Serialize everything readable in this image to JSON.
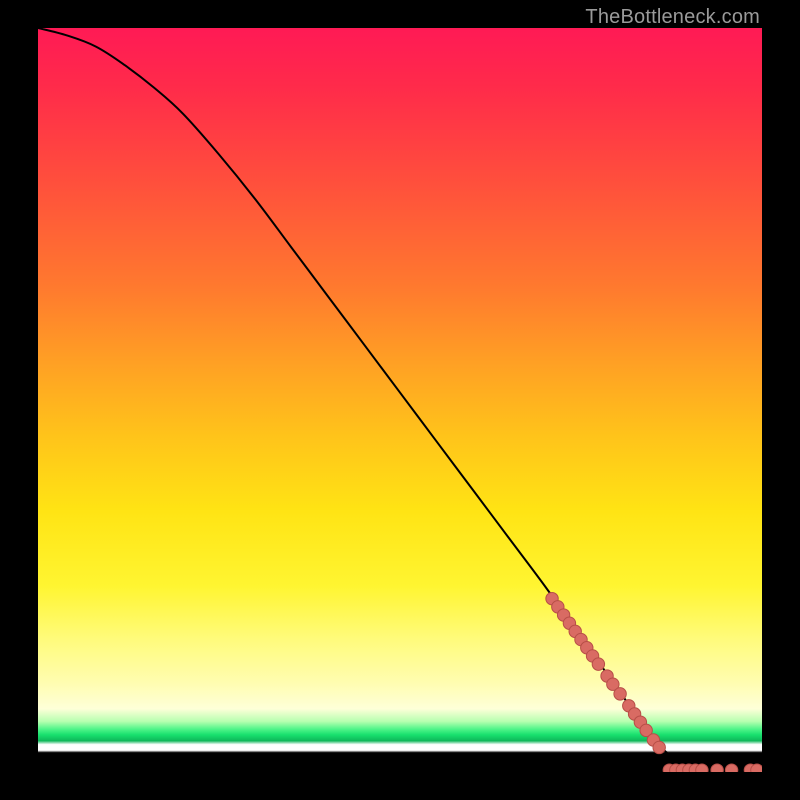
{
  "watermark": "TheBottleneck.com",
  "colors": {
    "curve": "#000000",
    "dot_fill": "#d96b63",
    "dot_stroke": "#b74e47"
  },
  "chart_data": {
    "type": "line",
    "title": "",
    "xlabel": "",
    "ylabel": "",
    "xlim": [
      0,
      100
    ],
    "ylim": [
      0,
      100
    ],
    "grid": false,
    "legend": false,
    "series": [
      {
        "name": "curve",
        "x": [
          0,
          4,
          8,
          12,
          16,
          20,
          25,
          30,
          35,
          40,
          45,
          50,
          55,
          60,
          65,
          70,
          74,
          78,
          82,
          85,
          88,
          90,
          92,
          94,
          96,
          98,
          100
        ],
        "y": [
          100,
          99,
          97.5,
          95,
          92,
          88.5,
          83,
          77,
          70.5,
          64,
          57.5,
          51,
          44.5,
          38,
          31.5,
          25,
          19.5,
          14,
          8.5,
          4.5,
          1.6,
          0.6,
          0.25,
          0.25,
          0.25,
          0.25,
          0.25
        ]
      }
    ],
    "dots_on_curve": {
      "name": "highlighted-segment",
      "x": [
        71.0,
        71.8,
        72.6,
        73.4,
        74.2,
        75.0,
        75.8,
        76.6,
        77.4,
        78.6,
        79.4,
        80.4,
        81.6,
        82.4,
        83.2,
        84.0,
        85.0,
        85.8
      ],
      "y": [
        23.3,
        22.2,
        21.1,
        20.0,
        18.9,
        17.8,
        16.7,
        15.6,
        14.5,
        12.9,
        11.8,
        10.5,
        8.9,
        7.8,
        6.7,
        5.6,
        4.3,
        3.3
      ]
    },
    "dots_flat": {
      "name": "baseline-dots",
      "x": [
        87.2,
        88.1,
        89.0,
        89.9,
        90.8,
        91.7,
        93.8,
        95.8,
        98.4,
        99.3
      ],
      "y": [
        0.25,
        0.25,
        0.25,
        0.25,
        0.25,
        0.25,
        0.25,
        0.25,
        0.25,
        0.25
      ]
    }
  }
}
